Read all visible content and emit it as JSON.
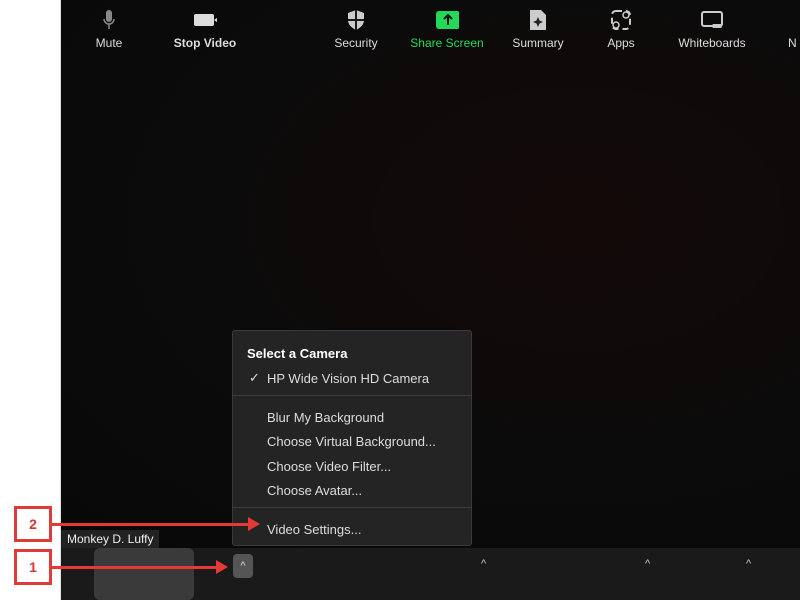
{
  "participant_name": "Monkey D. Luffy",
  "menu": {
    "header": "Select a Camera",
    "camera": "HP Wide Vision HD Camera",
    "check": "✓",
    "items": [
      "Blur My Background",
      "Choose Virtual Background...",
      "Choose Video Filter...",
      "Choose Avatar...",
      "Video Settings..."
    ]
  },
  "toolbar": {
    "mute": "Mute",
    "stop_video": "Stop Video",
    "security": "Security",
    "share_screen": "Share Screen",
    "summary": "Summary",
    "apps": "Apps",
    "whiteboards": "Whiteboards",
    "more": "N",
    "caret": "^"
  },
  "annotations": {
    "step1": "1",
    "step2": "2"
  },
  "colors": {
    "share_green": "#23d959",
    "annotation_red": "#e53935"
  }
}
